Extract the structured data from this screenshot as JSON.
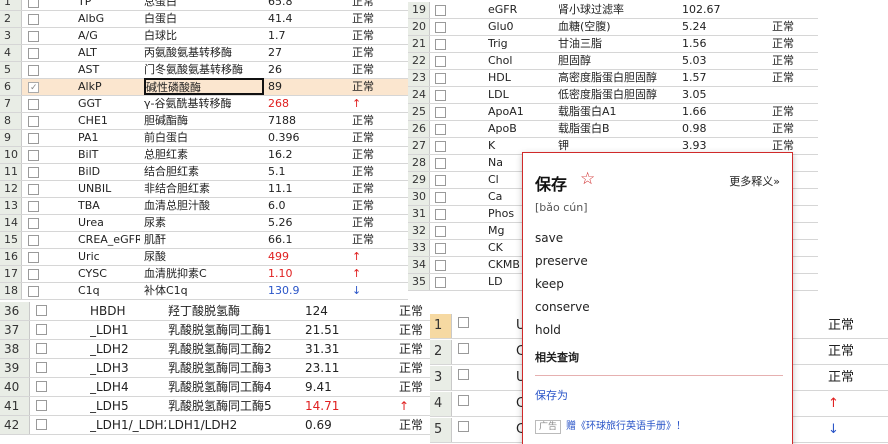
{
  "sheet_top_left": {
    "rows": [
      {
        "n": "1",
        "code": "TP",
        "name": "总蛋白",
        "value": "65.8",
        "flag": "正常"
      },
      {
        "n": "2",
        "code": "AlbG",
        "name": "白蛋白",
        "value": "41.4",
        "flag": "正常"
      },
      {
        "n": "3",
        "code": "A/G",
        "name": "白球比",
        "value": "1.7",
        "flag": "正常"
      },
      {
        "n": "4",
        "code": "ALT",
        "name": "丙氨酸氨基转移酶",
        "value": "27",
        "flag": "正常"
      },
      {
        "n": "5",
        "code": "AST",
        "name": "门冬氨酸氨基转移酶",
        "value": "26",
        "flag": "正常"
      },
      {
        "n": "6",
        "code": "AlkP",
        "name": "碱性磷酸酶",
        "value": "89",
        "flag": "正常"
      },
      {
        "n": "7",
        "code": "GGT",
        "name": "γ-谷氨酰基转移酶",
        "value": "268",
        "flag": "↑"
      },
      {
        "n": "8",
        "code": "CHE1",
        "name": "胆碱酯酶",
        "value": "7188",
        "flag": "正常"
      },
      {
        "n": "9",
        "code": "PA1",
        "name": "前白蛋白",
        "value": "0.396",
        "flag": "正常"
      },
      {
        "n": "10",
        "code": "BilT",
        "name": "总胆红素",
        "value": "16.2",
        "flag": "正常"
      },
      {
        "n": "11",
        "code": "BilD",
        "name": "结合胆红素",
        "value": "5.1",
        "flag": "正常"
      },
      {
        "n": "12",
        "code": "UNBIL",
        "name": "非结合胆红素",
        "value": "11.1",
        "flag": "正常"
      },
      {
        "n": "13",
        "code": "TBA",
        "name": "血清总胆汁酸",
        "value": "6.0",
        "flag": "正常"
      },
      {
        "n": "14",
        "code": "Urea",
        "name": "尿素",
        "value": "5.26",
        "flag": "正常"
      },
      {
        "n": "15",
        "code": "CREA_eGFR",
        "name": "肌酐",
        "value": "66.1",
        "flag": "正常"
      },
      {
        "n": "16",
        "code": "Uric",
        "name": "尿酸",
        "value": "499",
        "flag": "↑"
      },
      {
        "n": "17",
        "code": "CYSC",
        "name": "血清胱抑素C",
        "value": "1.10",
        "flag": "↑"
      },
      {
        "n": "18",
        "code": "C1q",
        "name": "补体C1q",
        "value": "130.9",
        "flag": "↓"
      }
    ]
  },
  "sheet_top_right": {
    "rows": [
      {
        "n": "19",
        "code": "eGFR",
        "name": "肾小球过滤率",
        "value": "102.67",
        "flag": ""
      },
      {
        "n": "20",
        "code": "Glu0",
        "name": "血糖(空腹)",
        "value": "5.24",
        "flag": "正常"
      },
      {
        "n": "21",
        "code": "Trig",
        "name": "甘油三脂",
        "value": "1.56",
        "flag": "正常"
      },
      {
        "n": "22",
        "code": "Chol",
        "name": "胆固醇",
        "value": "5.03",
        "flag": "正常"
      },
      {
        "n": "23",
        "code": "HDL",
        "name": "高密度脂蛋白胆固醇",
        "value": "1.57",
        "flag": "正常"
      },
      {
        "n": "24",
        "code": "LDL",
        "name": "低密度脂蛋白胆固醇",
        "value": "3.05",
        "flag": ""
      },
      {
        "n": "25",
        "code": "ApoA1",
        "name": "载脂蛋白A1",
        "value": "1.66",
        "flag": "正常"
      },
      {
        "n": "26",
        "code": "ApoB",
        "name": "载脂蛋白B",
        "value": "0.98",
        "flag": "正常"
      },
      {
        "n": "27",
        "code": "K",
        "name": "钾",
        "value": "3.93",
        "flag": "正常"
      },
      {
        "n": "28",
        "code": "Na",
        "name": "",
        "value": "",
        "flag": ""
      },
      {
        "n": "29",
        "code": "Cl",
        "name": "",
        "value": "",
        "flag": ""
      },
      {
        "n": "30",
        "code": "Ca",
        "name": "",
        "value": "",
        "flag": ""
      },
      {
        "n": "31",
        "code": "Phos",
        "name": "",
        "value": "",
        "flag": ""
      },
      {
        "n": "32",
        "code": "Mg",
        "name": "",
        "value": "",
        "flag": ""
      },
      {
        "n": "33",
        "code": "CK",
        "name": "",
        "value": "",
        "flag": ""
      },
      {
        "n": "34",
        "code": "CKMB",
        "name": "",
        "value": "",
        "flag": ""
      },
      {
        "n": "35",
        "code": "LD",
        "name": "",
        "value": "",
        "flag": ""
      }
    ]
  },
  "sheet_bottom_left": {
    "rows": [
      {
        "n": "36",
        "code": "HBDH",
        "name": "羟丁酸脱氢酶",
        "value": "124",
        "flag": "正常"
      },
      {
        "n": "37",
        "code": "_LDH1",
        "name": "乳酸脱氢酶同工酶1",
        "value": "21.51",
        "flag": "正常"
      },
      {
        "n": "38",
        "code": "_LDH2",
        "name": "乳酸脱氢酶同工酶2",
        "value": "31.31",
        "flag": "正常"
      },
      {
        "n": "39",
        "code": "_LDH3",
        "name": "乳酸脱氢酶同工酶3",
        "value": "23.11",
        "flag": "正常"
      },
      {
        "n": "40",
        "code": "_LDH4",
        "name": "乳酸脱氢酶同工酶4",
        "value": "9.41",
        "flag": "正常"
      },
      {
        "n": "41",
        "code": "_LDH5",
        "name": "乳酸脱氢酶同工酶5",
        "value": "14.71",
        "flag": "↑"
      },
      {
        "n": "42",
        "code": "_LDH1/_LDH2",
        "name": "LDH1/LDH2",
        "value": "0.69",
        "flag": "正常"
      }
    ]
  },
  "sheet_bottom_right": {
    "rows": [
      {
        "n": "1",
        "code": "U",
        "flag": "正常"
      },
      {
        "n": "2",
        "code": "C",
        "flag": "正常"
      },
      {
        "n": "3",
        "code": "U",
        "flag": "正常"
      },
      {
        "n": "4",
        "code": "C",
        "flag": "↑"
      },
      {
        "n": "5",
        "code": "C",
        "flag": "↓"
      }
    ]
  },
  "dictionary_popup": {
    "word": "保存",
    "star": "☆",
    "more_link": "更多释义»",
    "pinyin": "[bǎo cún]",
    "definitions": [
      "save",
      "preserve",
      "keep",
      "conserve",
      "hold"
    ],
    "related_title": "相关查询",
    "related_link": "保存为",
    "ad_badge": "广告",
    "ad_text": "赠《环球旅行英语手册》！"
  },
  "colors": {
    "accent_red": "#d02a2a",
    "high_flag": "#e02020",
    "low_flag": "#2a55c8",
    "row_number_bg": "#e9ede6",
    "selected_row_bg": "#fbe6cf"
  }
}
